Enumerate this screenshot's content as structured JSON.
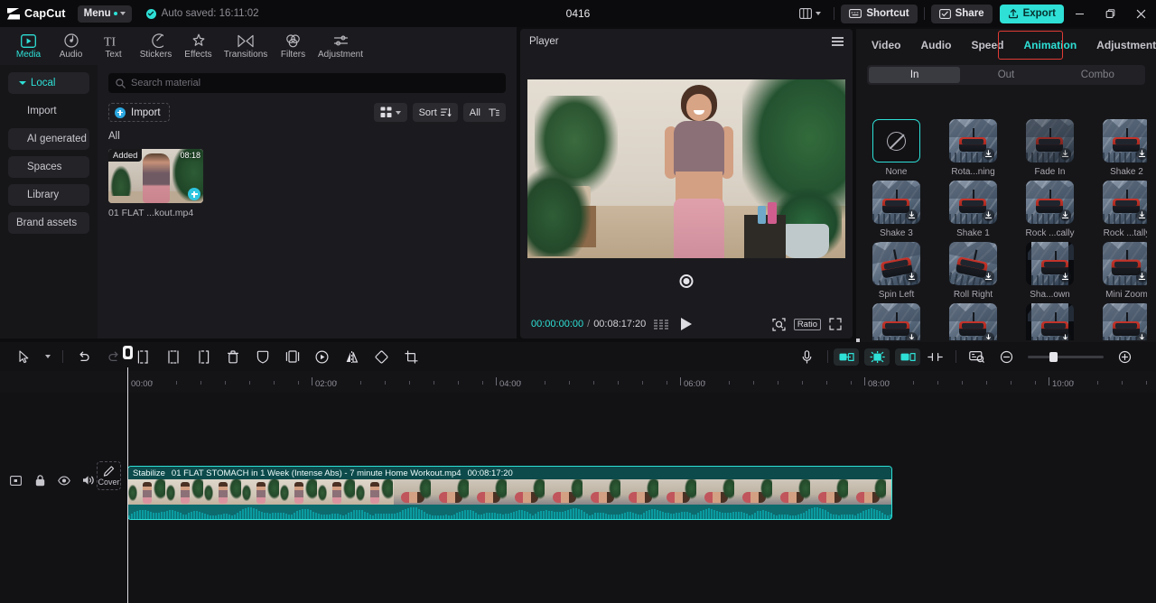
{
  "titlebar": {
    "app_name": "CapCut",
    "menu_label": "Menu",
    "autosave_text": "Auto saved: 16:11:02",
    "project_title": "0416",
    "shortcut_label": "Shortcut",
    "share_label": "Share",
    "export_label": "Export",
    "accent_color": "#2ee0d6",
    "icons": {
      "layout": "layout-icon",
      "minimize": "minimize-icon",
      "maximize": "maximize-icon",
      "close": "close-icon"
    }
  },
  "topnav": {
    "items": [
      {
        "label": "Media",
        "icon": "media-icon",
        "active": true
      },
      {
        "label": "Audio",
        "icon": "audio-icon",
        "active": false
      },
      {
        "label": "Text",
        "icon": "text-icon",
        "active": false
      },
      {
        "label": "Stickers",
        "icon": "stickers-icon",
        "active": false
      },
      {
        "label": "Effects",
        "icon": "effects-icon",
        "active": false
      },
      {
        "label": "Transitions",
        "icon": "transitions-icon",
        "active": false
      },
      {
        "label": "Filters",
        "icon": "filters-icon",
        "active": false
      },
      {
        "label": "Adjustment",
        "icon": "adjustment-icon",
        "active": false
      }
    ]
  },
  "sidebar": {
    "items": [
      {
        "label": "Local",
        "selected": true,
        "expandable": true
      },
      {
        "label": "Import",
        "selected": false,
        "expandable": false
      },
      {
        "label": "AI generated",
        "selected": false,
        "expandable": false
      },
      {
        "label": "Spaces",
        "selected": false,
        "expandable": false
      },
      {
        "label": "Library",
        "selected": false,
        "expandable": false
      },
      {
        "label": "Brand assets",
        "selected": false,
        "expandable": true
      }
    ]
  },
  "media": {
    "search_placeholder": "Search material",
    "import_label": "Import",
    "sort_label": "Sort",
    "filter_label": "All",
    "group_label": "All",
    "item": {
      "badge": "Added",
      "duration": "08:18",
      "name": "01 FLAT ...kout.mp4"
    }
  },
  "player": {
    "title": "Player",
    "current_time": "00:00:00:00",
    "total_time": "00:08:17:20",
    "ratio_label": "Ratio",
    "icons": {
      "menu": "hamburger-icon",
      "play": "play-icon",
      "frames": "frames-icon",
      "zoom": "zoom-preview-icon",
      "fullscreen": "fullscreen-icon",
      "recenter": "recenter-icon"
    }
  },
  "right_panel": {
    "tabs": [
      {
        "label": "Video",
        "active": false
      },
      {
        "label": "Audio",
        "active": false
      },
      {
        "label": "Speed",
        "active": false
      },
      {
        "label": "Animation",
        "active": true,
        "highlighted": true
      },
      {
        "label": "Adjustment",
        "active": false
      }
    ],
    "highlight_color": "#e13b34",
    "segments": [
      {
        "label": "In",
        "active": true
      },
      {
        "label": "Out",
        "active": false
      },
      {
        "label": "Combo",
        "active": false
      }
    ],
    "animations": [
      {
        "label": "None",
        "type": "none",
        "selected": true,
        "downloadable": false
      },
      {
        "label": "Rota...ning",
        "type": "thumb",
        "selected": false,
        "downloadable": true
      },
      {
        "label": "Fade In",
        "type": "thumb",
        "selected": false,
        "downloadable": true
      },
      {
        "label": "Shake 2",
        "type": "thumb",
        "selected": false,
        "downloadable": true
      },
      {
        "label": "Shake 3",
        "type": "thumb",
        "selected": false,
        "downloadable": true
      },
      {
        "label": "Shake 1",
        "type": "thumb",
        "selected": false,
        "downloadable": true
      },
      {
        "label": "Rock ...cally",
        "type": "thumb",
        "selected": false,
        "downloadable": true
      },
      {
        "label": "Rock ...tally",
        "type": "thumb",
        "selected": false,
        "downloadable": true
      },
      {
        "label": "Spin Left",
        "type": "thumb",
        "selected": false,
        "downloadable": true
      },
      {
        "label": "Roll Right",
        "type": "thumb",
        "selected": false,
        "downloadable": true
      },
      {
        "label": "Sha...own",
        "type": "thumb",
        "selected": false,
        "downloadable": true
      },
      {
        "label": "Mini Zoom",
        "type": "thumb",
        "selected": false,
        "downloadable": true
      },
      {
        "label": "",
        "type": "thumb",
        "selected": false,
        "downloadable": true
      },
      {
        "label": "",
        "type": "thumb",
        "selected": false,
        "downloadable": true
      },
      {
        "label": "",
        "type": "thumb",
        "selected": false,
        "downloadable": true
      },
      {
        "label": "",
        "type": "thumb",
        "selected": false,
        "downloadable": true
      }
    ]
  },
  "timeline": {
    "tools": [
      "select-icon",
      "select-dropdown-icon",
      "undo-icon",
      "redo-icon",
      "split-left-icon",
      "split-icon",
      "split-right-icon",
      "delete-icon",
      "mask-icon",
      "crop-frame-icon",
      "keyframe-icon",
      "mirror-icon",
      "rotate-icon",
      "crop-icon"
    ],
    "right_tools": [
      "microphone-icon",
      "trim-start-icon",
      "auto-edit-icon",
      "trim-end-icon",
      "split-marker-icon",
      "preview-icon",
      "zoom-out-icon",
      "zoom-in-icon"
    ],
    "ruler_labels": [
      "00:00",
      "02:00",
      "04:00",
      "06:00",
      "08:00",
      "10:00"
    ],
    "playhead_time": "00:00",
    "track_controls": [
      "track-icon",
      "lock-icon",
      "eye-icon",
      "volume-icon"
    ],
    "cover_label": "Cover",
    "clip": {
      "stabilize_label": "Stabilize",
      "name": "01 FLAT STOMACH in 1 Week (Intense Abs) - 7 minute Home Workout.mp4",
      "duration": "00:08:17:20",
      "border_color": "#2ee0d6"
    }
  }
}
